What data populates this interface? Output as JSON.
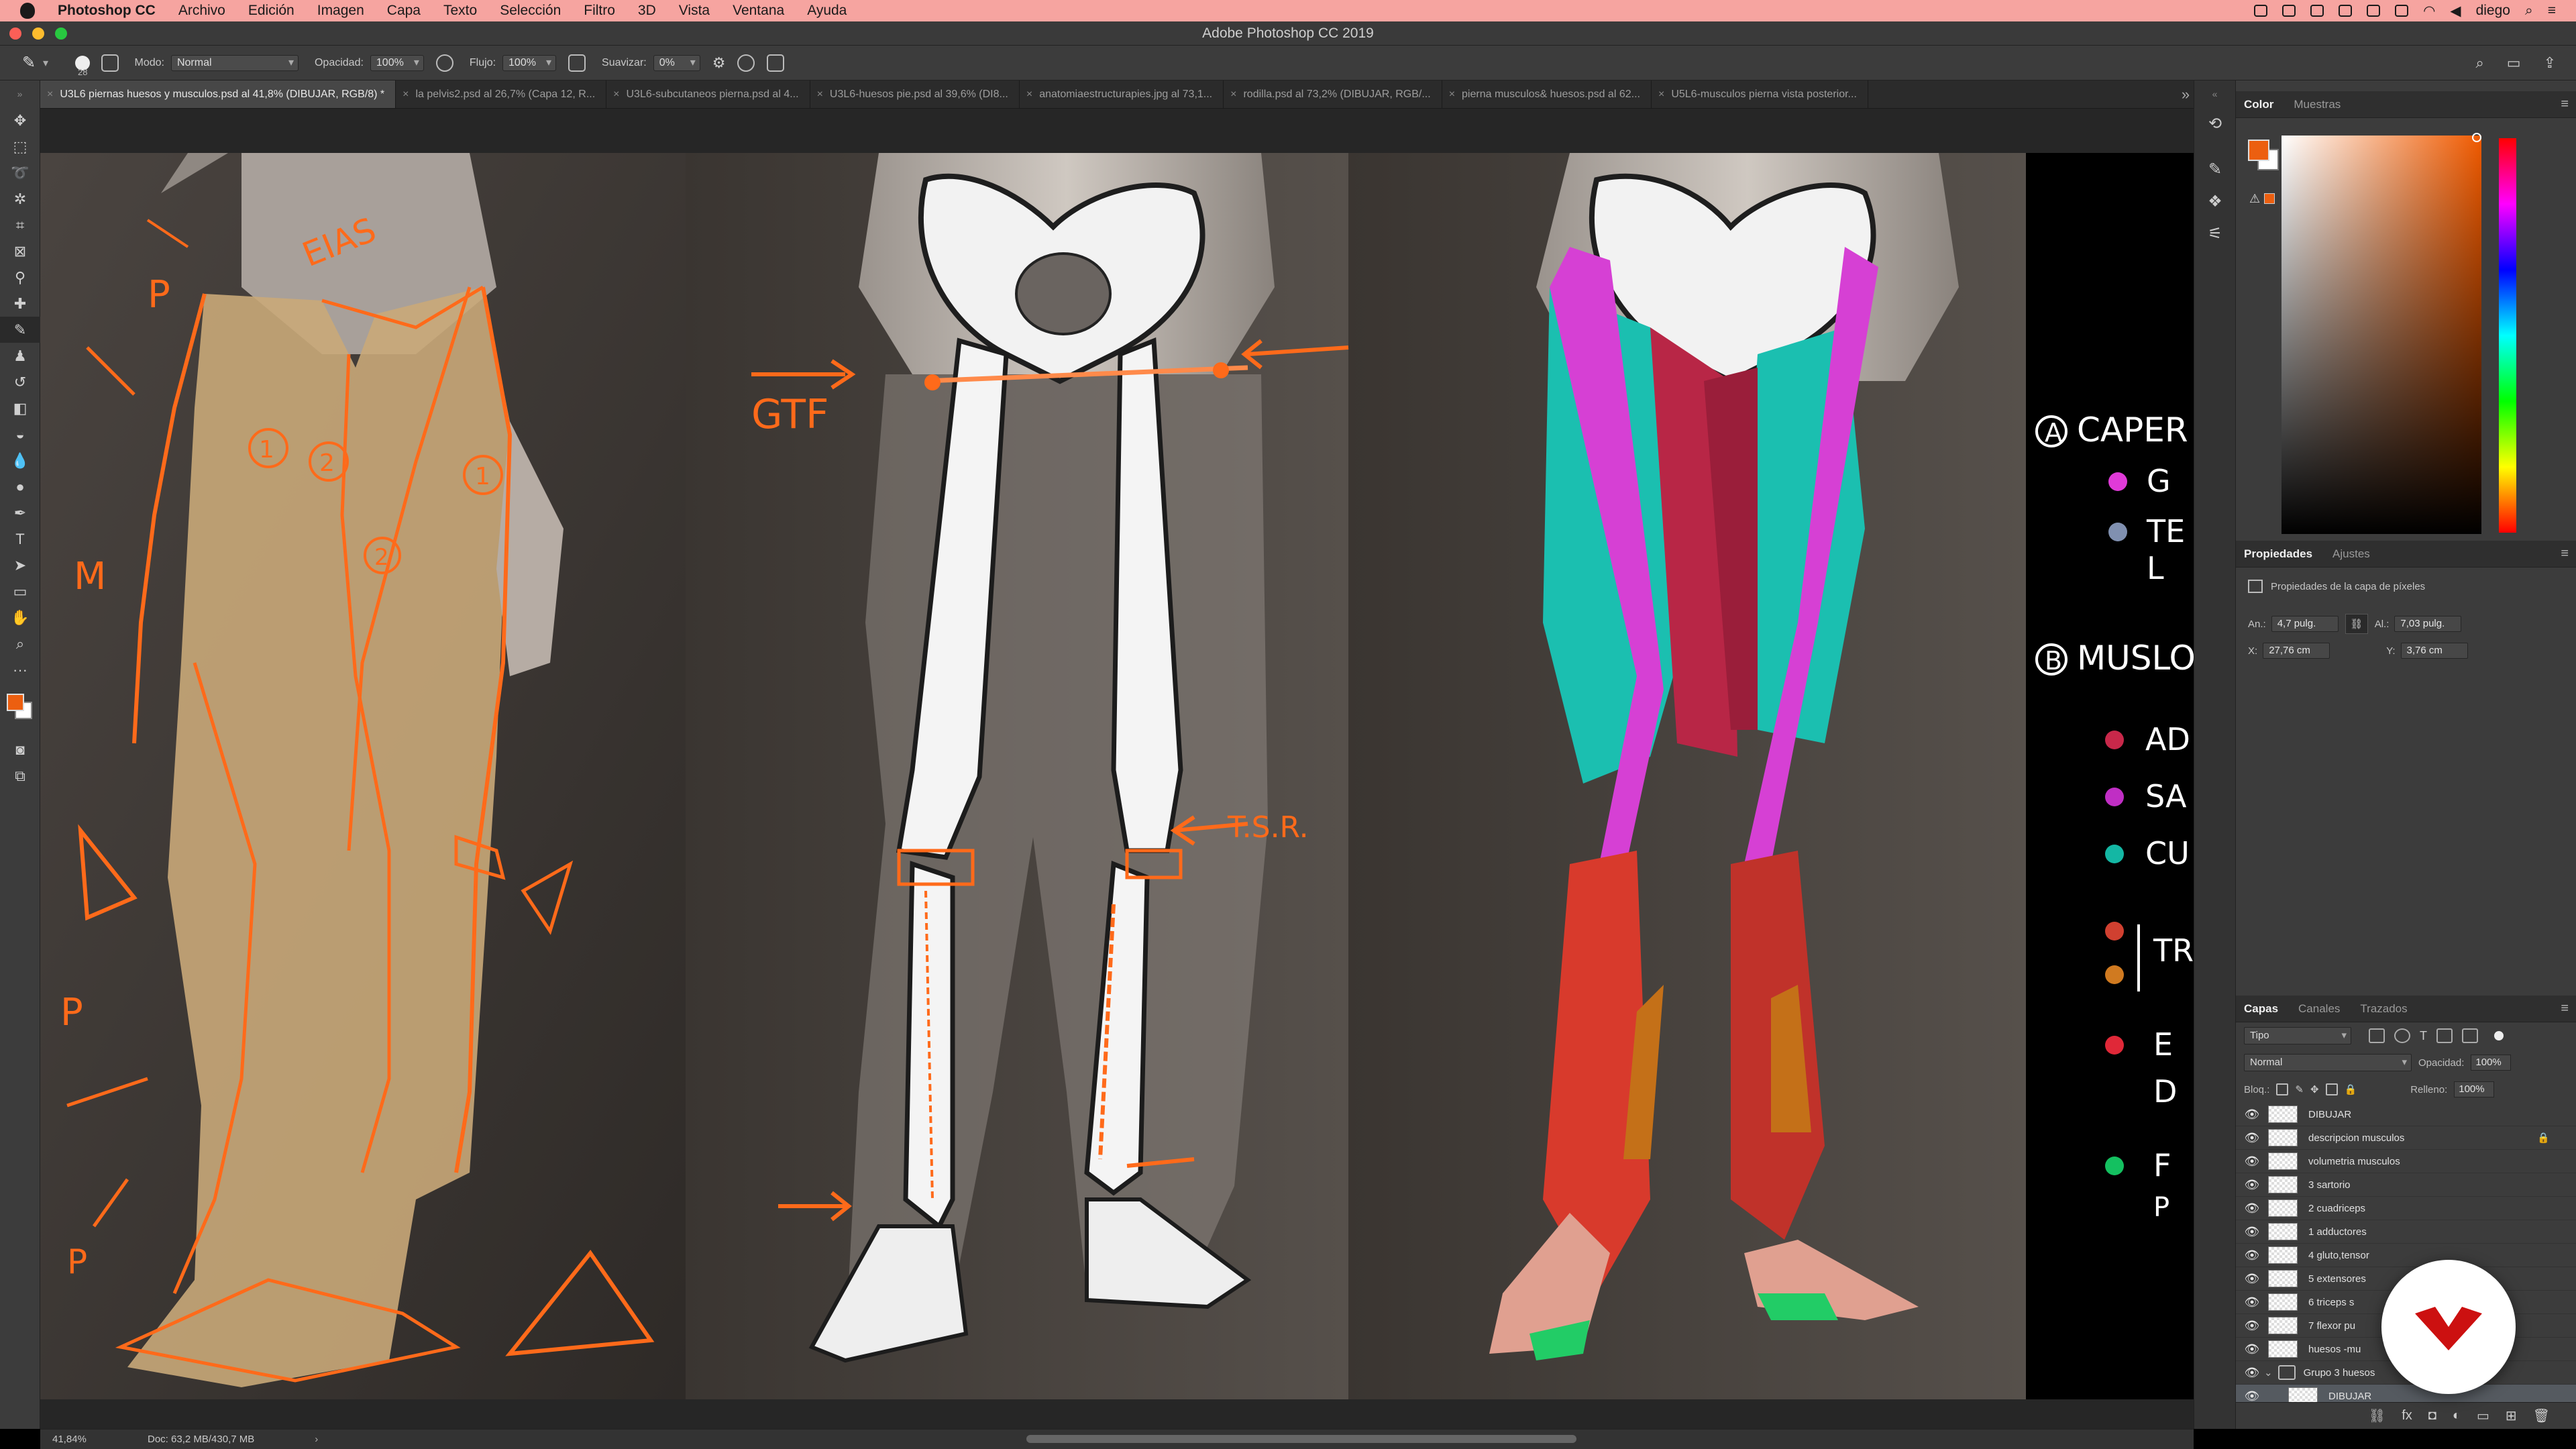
{
  "menubar": {
    "app_name": "Photoshop CC",
    "items": [
      "Archivo",
      "Edición",
      "Imagen",
      "Capa",
      "Texto",
      "Selección",
      "Filtro",
      "3D",
      "Vista",
      "Ventana",
      "Ayuda"
    ],
    "user": "diego"
  },
  "window": {
    "title": "Adobe Photoshop CC 2019"
  },
  "options": {
    "brush_size": "28",
    "mode_label": "Modo:",
    "mode_value": "Normal",
    "opacity_label": "Opacidad:",
    "opacity_value": "100%",
    "flow_label": "Flujo:",
    "flow_value": "100%",
    "smoothing_label": "Suavizar:",
    "smoothing_value": "0%"
  },
  "tabs": [
    {
      "label": "U3L6 piernas huesos y musculos.psd al 41,8% (DIBUJAR, RGB/8) *",
      "active": true
    },
    {
      "label": "la pelvis2.psd al 26,7% (Capa 12, R...",
      "active": false
    },
    {
      "label": "U3L6-subcutaneos pierna.psd al 4...",
      "active": false
    },
    {
      "label": "U3L6-huesos pie.psd al 39,6% (DI8...",
      "active": false
    },
    {
      "label": "anatomiaestructurapies.jpg al 73,1...",
      "active": false
    },
    {
      "label": "rodilla.psd al 73,2% (DIBUJAR, RGB/...",
      "active": false
    },
    {
      "label": "pierna musculos& huesos.psd al 62...",
      "active": false
    },
    {
      "label": "U5L6-musculos pierna vista posterior...",
      "active": false
    }
  ],
  "tabs_more": "»",
  "annotations": {
    "p1_eias": "EIAS",
    "p1_p_top": "P",
    "p1_m": "M",
    "p1_p_mid": "P",
    "p1_p_low": "P",
    "p1_n1": "1",
    "p1_n2": "2",
    "p1_n1b": "1",
    "p1_n2b": "2",
    "p2_gtf": "GTF",
    "p2_tsr": "T.S.R."
  },
  "legend": {
    "section_a_letter": "A",
    "section_a_text": "CAPER",
    "section_b_letter": "B",
    "section_b_text": "MUSLO",
    "a_items": [
      {
        "text": "G",
        "color": "#e03ad8"
      },
      {
        "text": "TE",
        "color": "#8090b0"
      },
      {
        "text": "L",
        "color": ""
      }
    ],
    "b_items": [
      {
        "text": "AD",
        "color": "#c8284a"
      },
      {
        "text": "SA",
        "color": "#c02ec4"
      },
      {
        "text": "CU",
        "color": "#14b7a4"
      },
      {
        "text": "TR",
        "color": "#d04030"
      },
      {
        "text": "",
        "color": "#d07a20"
      },
      {
        "text": "E",
        "color": "#e02838"
      },
      {
        "text": "D",
        "color": ""
      },
      {
        "text": "F",
        "color": "#14c060"
      },
      {
        "text": "P",
        "color": ""
      }
    ]
  },
  "color_panel": {
    "tab_color": "Color",
    "tab_swatches": "Muestras",
    "foreground": "#ec5f10",
    "background": "#ffffff"
  },
  "properties": {
    "tab_props": "Propiedades",
    "tab_adjust": "Ajustes",
    "subtitle": "Propiedades de la capa de píxeles",
    "w_label": "An.:",
    "w_value": "4,7 pulg.",
    "h_label": "Al.:",
    "h_value": "7,03 pulg.",
    "x_label": "X:",
    "x_value": "27,76 cm",
    "y_label": "Y:",
    "y_value": "3,76 cm"
  },
  "layers_panel": {
    "tab_layers": "Capas",
    "tab_channels": "Canales",
    "tab_paths": "Trazados",
    "kind_filter": "Tipo",
    "blend_mode": "Normal",
    "opacity_label": "Opacidad:",
    "opacity_value": "100%",
    "lock_label": "Bloq.:",
    "fill_label": "Relleno:",
    "fill_value": "100%",
    "layers": [
      {
        "name": "DIBUJAR",
        "type": "layer",
        "locked": false,
        "selected": false
      },
      {
        "name": "descripcion musculos",
        "type": "layer",
        "locked": true,
        "selected": false
      },
      {
        "name": "volumetria musculos",
        "type": "layer",
        "locked": false,
        "selected": false
      },
      {
        "name": "3 sartorio",
        "type": "layer",
        "locked": false,
        "selected": false
      },
      {
        "name": "2 cuadriceps",
        "type": "layer",
        "locked": false,
        "selected": false
      },
      {
        "name": "1 adductores",
        "type": "layer",
        "locked": false,
        "selected": false
      },
      {
        "name": "4 gluto,tensor",
        "type": "layer",
        "locked": false,
        "selected": false
      },
      {
        "name": "5 extensores",
        "type": "layer",
        "locked": false,
        "selected": false
      },
      {
        "name": "6 triceps s",
        "type": "layer",
        "locked": false,
        "selected": false
      },
      {
        "name": "7 flexor pu",
        "type": "layer",
        "locked": false,
        "selected": false
      },
      {
        "name": "huesos -mu",
        "type": "layer",
        "locked": false,
        "selected": false
      },
      {
        "name": "Grupo 3 huesos",
        "type": "group",
        "locked": false,
        "selected": false
      },
      {
        "name": "DIBUJAR",
        "type": "layer",
        "locked": false,
        "selected": true
      }
    ]
  },
  "status": {
    "zoom": "41,84%",
    "doc": "Doc: 63,2 MB/430,7 MB",
    "chevron": "›"
  }
}
